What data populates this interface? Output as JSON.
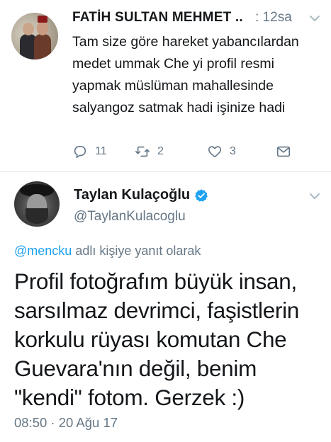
{
  "tweet1": {
    "author_name": "FATİH SULTAN MEHMET ..",
    "meta": ": 12sa",
    "text": "Tam size göre hareket yabancılardan medet ummak Che yi profil resmi yapmak müslüman mahallesinde salyangoz satmak hadi işinize hadi",
    "actions": {
      "reply_count": "11",
      "retweet_count": "2",
      "like_count": "3"
    }
  },
  "tweet2": {
    "author_name": "Taylan Kulaçoğlu",
    "handle": "@TaylanKulacoglu",
    "reply_to_mention": "@mencku",
    "reply_to_suffix": " adlı kişiye yanıt olarak",
    "text": "Profil fotoğrafım büyük insan, sarsılmaz devrimci, faşistlerin korkulu rüyası komutan Che Guevara'nın değil, benim \"kendi\" fotom. Gerzek :)",
    "timestamp": "08:50 · 20 Ağu 17"
  },
  "colors": {
    "accent": "#1da1f2",
    "muted": "#657786",
    "text": "#14171a",
    "divider": "#e1e8ed"
  },
  "icons": [
    "reply-icon",
    "retweet-icon",
    "like-icon",
    "direct-message-icon",
    "chevron-down-icon",
    "verified-badge-icon"
  ]
}
